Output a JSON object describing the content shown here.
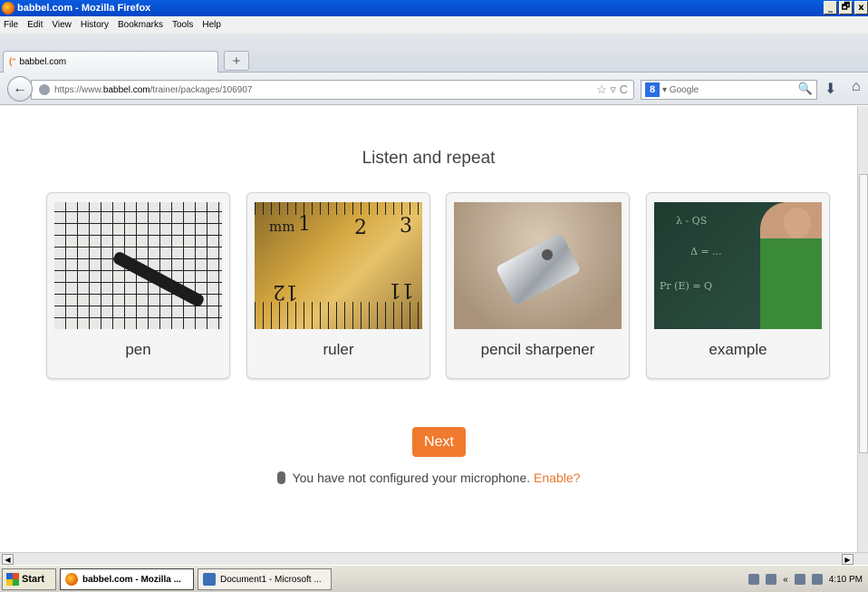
{
  "window": {
    "title": "babbel.com - Mozilla Firefox",
    "btn_min": "_",
    "btn_max": "🗗",
    "btn_close": "x"
  },
  "menu": [
    "File",
    "Edit",
    "View",
    "History",
    "Bookmarks",
    "Tools",
    "Help"
  ],
  "tab": {
    "favicon": "(ᵔ",
    "label": "babbel.com",
    "new_tab": "+"
  },
  "nav": {
    "back": "←",
    "url_prefix": "https://www.",
    "url_domain": "babbel.com",
    "url_path": "/trainer/packages/106907",
    "url_icons": "☆ ▿ C",
    "search_logo": "8",
    "search_placeholder": "▾ Google",
    "search_icon": "🔍",
    "download_icon": "⬇",
    "home_icon": "⌂"
  },
  "page": {
    "title": "Listen and repeat",
    "cards": [
      {
        "label": "pen",
        "image": "pen-on-grid"
      },
      {
        "label": "ruler",
        "image": "ruler-closeup",
        "numbers": [
          "mm",
          "1",
          "2",
          "3",
          "12",
          "11"
        ]
      },
      {
        "label": "pencil sharpener",
        "image": "metal-sharpener"
      },
      {
        "label": "example",
        "image": "man-at-chalkboard",
        "chalk": [
          "λ - QS",
          "Pr (E) = Q",
          "Δ = ..."
        ]
      }
    ],
    "next_label": "Next",
    "mic_text": "You have not configured your microphone.",
    "enable_link": "Enable?"
  },
  "scroll": {
    "left": "◀",
    "right": "▶"
  },
  "taskbar": {
    "start": "Start",
    "tasks": [
      {
        "label": "babbel.com - Mozilla ...",
        "active": true
      },
      {
        "label": "Document1 - Microsoft ...",
        "active": false
      }
    ],
    "tray_arrows": "«",
    "time": "4:10 PM"
  },
  "colors": {
    "accent": "#f07a2d",
    "titlebar": "#0a5ce0",
    "taskbar": "#d4d0c8"
  }
}
